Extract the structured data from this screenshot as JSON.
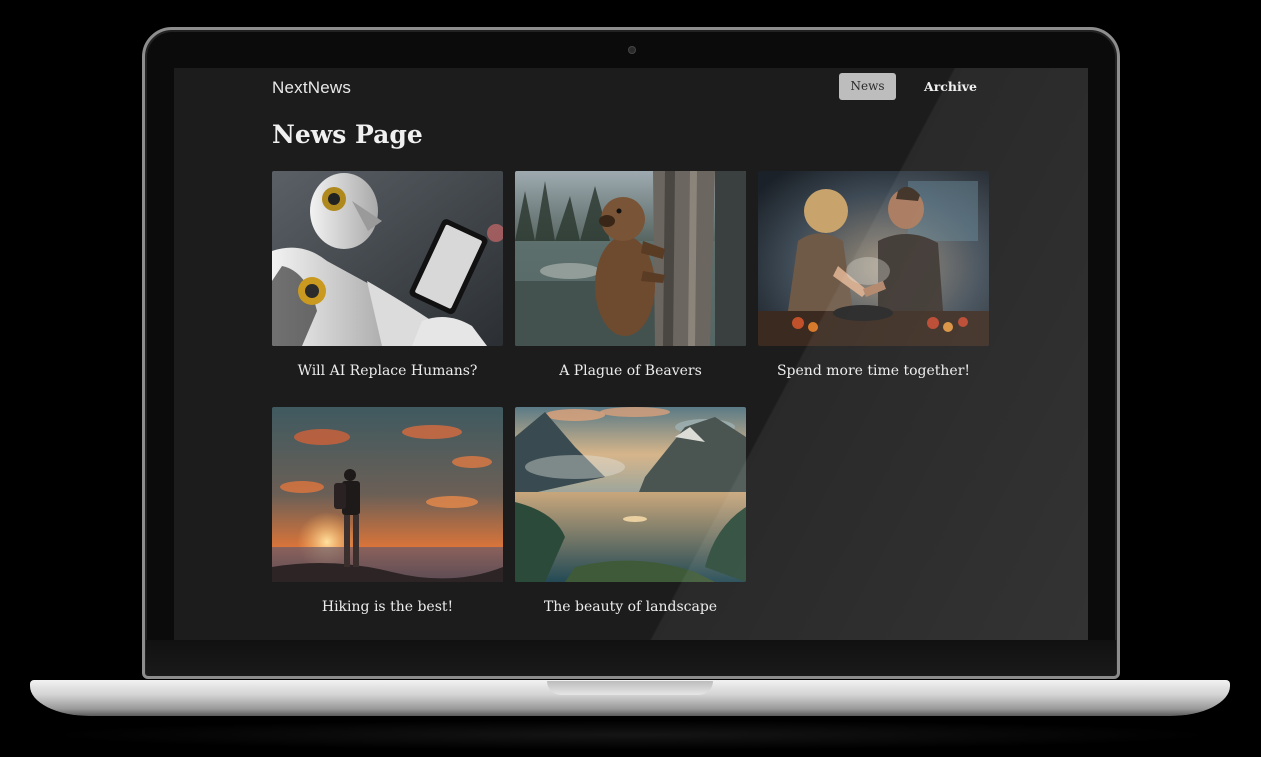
{
  "app": {
    "brand": "NextNews"
  },
  "nav": {
    "items": [
      {
        "label": "News",
        "active": true
      },
      {
        "label": "Archive",
        "active": false
      }
    ]
  },
  "page": {
    "title": "News Page"
  },
  "articles": [
    {
      "title": "Will AI Replace Humans?",
      "image": "robot-with-tablet"
    },
    {
      "title": "A Plague of Beavers",
      "image": "beaver-on-tree"
    },
    {
      "title": "Spend more time together!",
      "image": "couple-cooking"
    },
    {
      "title": "Hiking is the best!",
      "image": "hiker-at-sunset"
    },
    {
      "title": "The beauty of landscape",
      "image": "mountain-lake"
    }
  ],
  "colors": {
    "screen_background": "#1c1c1c",
    "active_nav_background": "#bdbdbd",
    "text": "#ececec"
  }
}
